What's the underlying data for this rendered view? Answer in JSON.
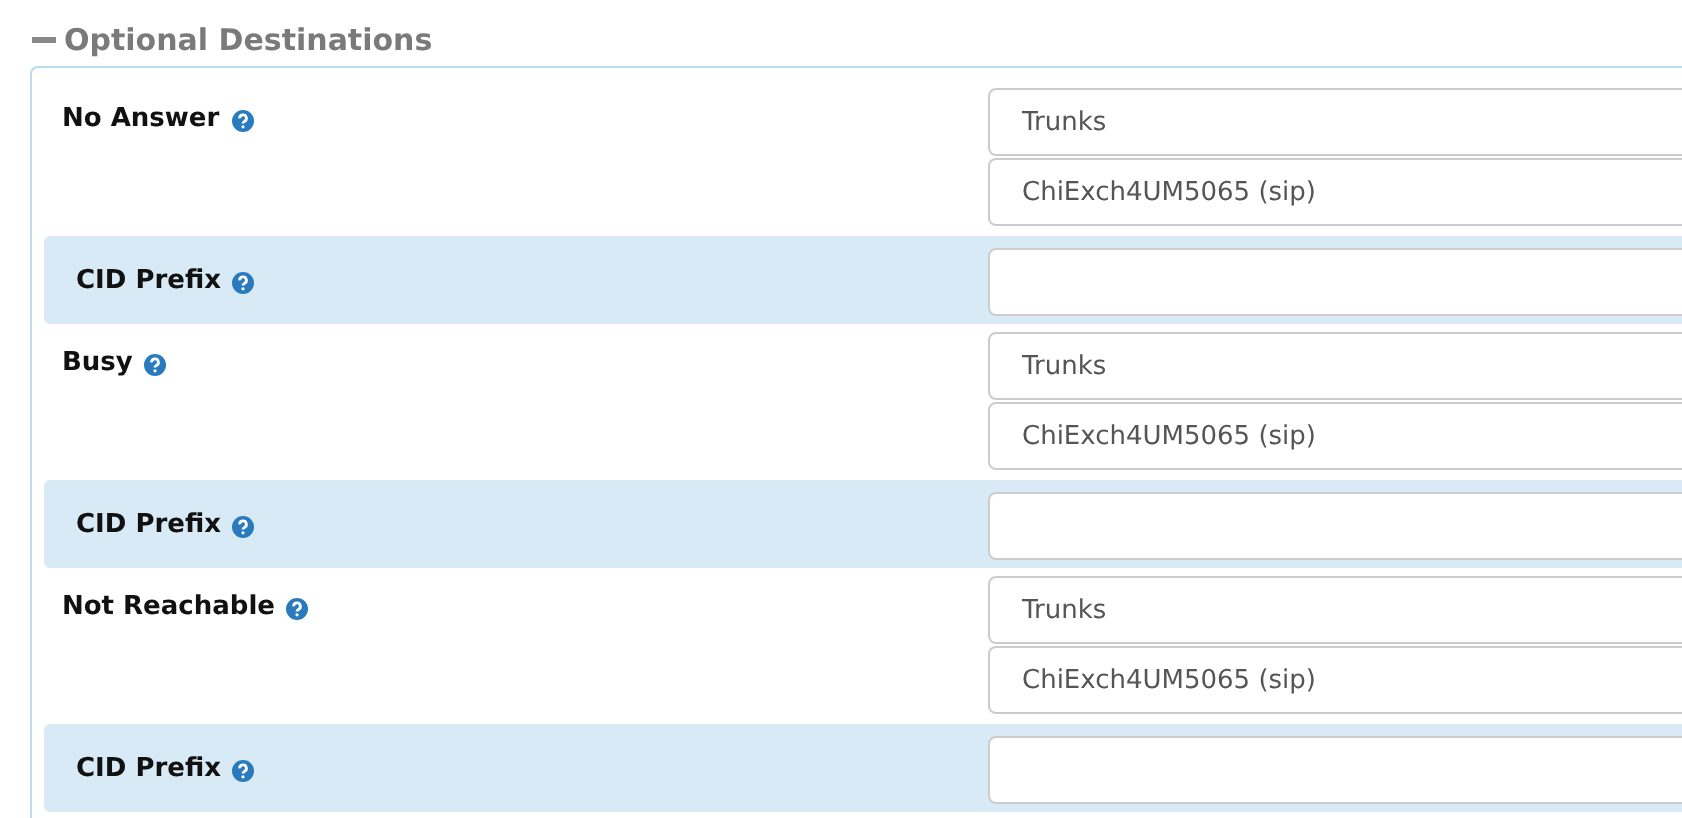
{
  "section": {
    "title": "Optional Destinations",
    "expanded": true
  },
  "rows": [
    {
      "kind": "destination",
      "label": "No Answer",
      "selects": [
        "Trunks",
        "ChiExch4UM5065 (sip)"
      ]
    },
    {
      "kind": "cid",
      "label": "CID Prefix"
    },
    {
      "kind": "destination",
      "label": "Busy",
      "selects": [
        "Trunks",
        "ChiExch4UM5065 (sip)"
      ]
    },
    {
      "kind": "cid",
      "label": "CID Prefix"
    },
    {
      "kind": "destination",
      "label": "Not Reachable",
      "selects": [
        "Trunks",
        "ChiExch4UM5065 (sip)"
      ]
    },
    {
      "kind": "cid",
      "label": "CID Prefix"
    }
  ]
}
